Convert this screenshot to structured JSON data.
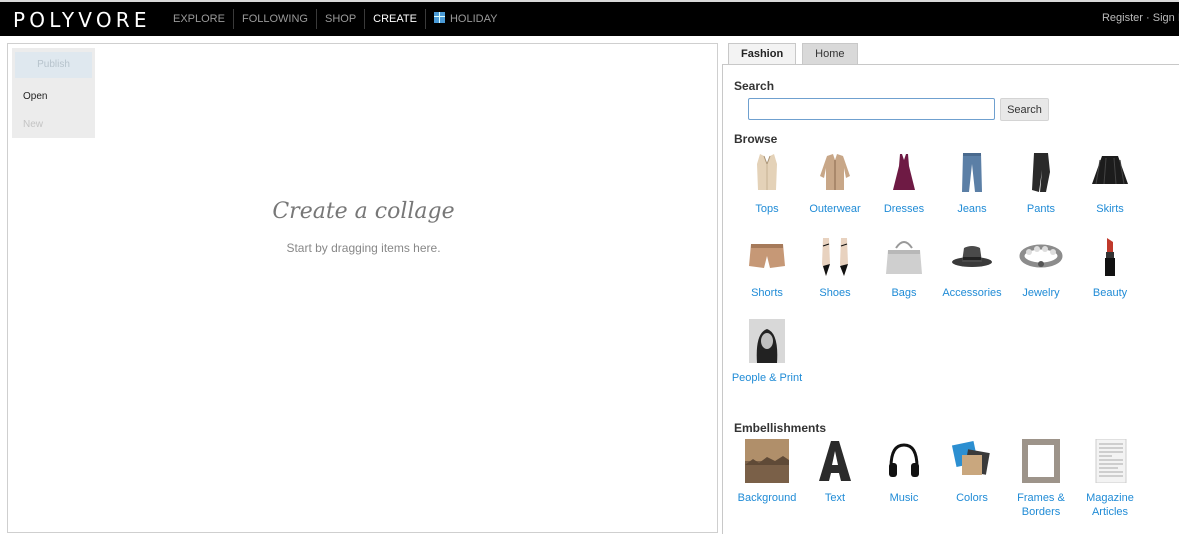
{
  "header": {
    "logo": "POLYVORE",
    "nav": [
      "EXPLORE",
      "FOLLOWING",
      "SHOP",
      "CREATE",
      "HOLIDAY"
    ],
    "register": "Register",
    "separator": "·",
    "signin": "Sign In"
  },
  "canvas": {
    "menu": {
      "publish": "Publish",
      "open": "Open",
      "new": "New"
    },
    "title": "Create a collage",
    "subtitle": "Start by dragging items here."
  },
  "panel": {
    "tabs": [
      "Fashion",
      "Home"
    ],
    "search_title": "Search",
    "search_value": "",
    "search_button": "Search",
    "browse_title": "Browse",
    "browse": [
      "Tops",
      "Outerwear",
      "Dresses",
      "Jeans",
      "Pants",
      "Skirts",
      "Shorts",
      "Shoes",
      "Bags",
      "Accessories",
      "Jewelry",
      "Beauty",
      "People & Print"
    ],
    "embellishments_title": "Embellishments",
    "embellishments": [
      "Background",
      "Text",
      "Music",
      "Colors",
      "Frames & Borders",
      "Magazine Articles"
    ]
  },
  "colors": {
    "link": "#1f8bd6",
    "topbar": "#000000",
    "accent_input": "#6fa0cf"
  }
}
